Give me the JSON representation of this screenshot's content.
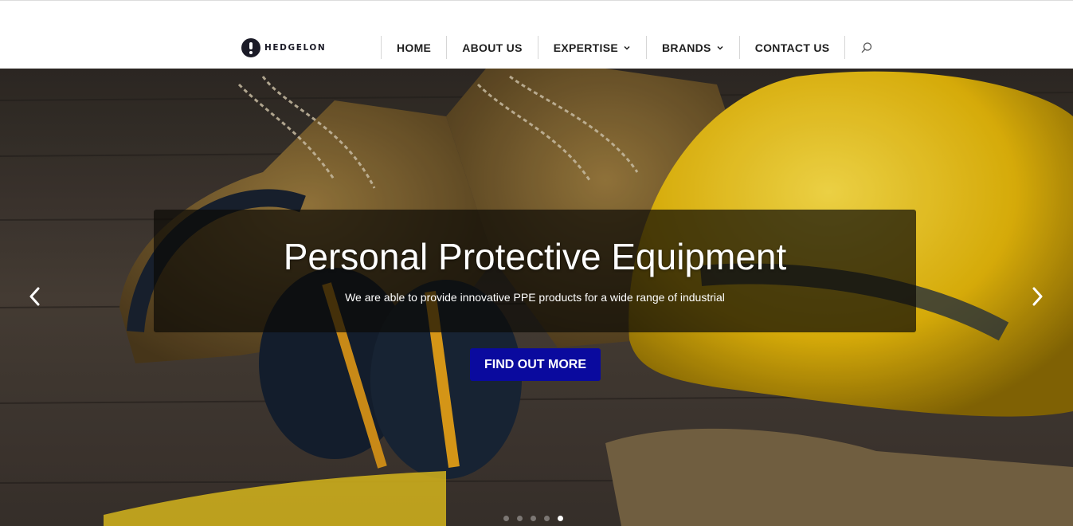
{
  "brand": {
    "name": "HEDGELON"
  },
  "nav": {
    "items": [
      {
        "label": "HOME",
        "has_dropdown": false
      },
      {
        "label": "ABOUT US",
        "has_dropdown": false
      },
      {
        "label": "EXPERTISE",
        "has_dropdown": true
      },
      {
        "label": "BRANDS",
        "has_dropdown": true
      },
      {
        "label": "CONTACT US",
        "has_dropdown": false
      }
    ],
    "search_icon": "search-icon"
  },
  "hero": {
    "title": "Personal Protective Equipment",
    "subtitle": "We are able to provide innovative PPE products for a wide range of industrial",
    "cta_label": "FIND OUT MORE",
    "prev_icon": "chevron-left-icon",
    "next_icon": "chevron-right-icon",
    "slide_count": 5,
    "active_slide": 5
  },
  "colors": {
    "cta_background": "#0a0a9e",
    "nav_text": "#1f1f1f",
    "helmet_yellow": "#f2c40d"
  }
}
